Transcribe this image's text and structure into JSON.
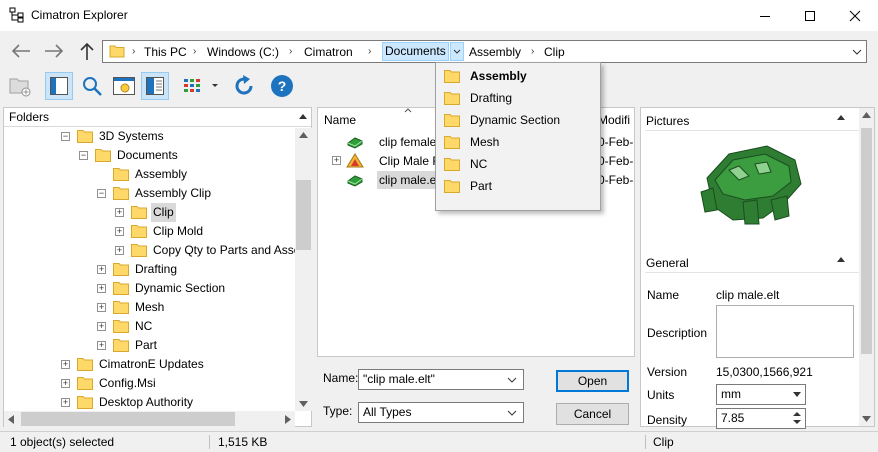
{
  "window": {
    "title": "Cimatron Explorer",
    "minimize_icon": "minimize-icon",
    "maximize_icon": "maximize-icon",
    "close_icon": "close-icon"
  },
  "address": {
    "breadcrumbs": [
      "This PC",
      "Windows (C:)",
      "Cimatron",
      "Documents",
      "Assembly",
      "Clip"
    ],
    "active_crumb": "Documents",
    "separator": "›"
  },
  "dropdown_menu": {
    "items": [
      "Assembly",
      "Drafting",
      "Dynamic Section",
      "Mesh",
      "NC",
      "Part"
    ],
    "bold_item": "Assembly"
  },
  "folders_panel": {
    "header": "Folders",
    "tree": [
      {
        "label": "3D Systems",
        "expander": "−"
      },
      {
        "label": "Documents",
        "expander": "−"
      },
      {
        "label": "Assembly",
        "expander": ""
      },
      {
        "label": "Assembly Clip",
        "expander": "−"
      },
      {
        "label": "Clip",
        "expander": "+"
      },
      {
        "label": "Clip Mold",
        "expander": "+"
      },
      {
        "label": "Copy Qty to Parts and Asse",
        "expander": "+"
      },
      {
        "label": "Drafting",
        "expander": "+"
      },
      {
        "label": "Dynamic Section",
        "expander": "+"
      },
      {
        "label": "Mesh",
        "expander": "+"
      },
      {
        "label": "NC",
        "expander": "+"
      },
      {
        "label": "Part",
        "expander": "+"
      },
      {
        "label": "CimatronE Updates",
        "expander": "+"
      },
      {
        "label": "Config.Msi",
        "expander": "+"
      },
      {
        "label": "Desktop Authority",
        "expander": "+"
      }
    ]
  },
  "files_panel": {
    "column_name": "Name",
    "column_modified": "Modifi",
    "files": [
      {
        "name": "clip female",
        "modified": "0-Feb-",
        "expander": ""
      },
      {
        "name": "Clip Male F",
        "modified": "0-Feb-",
        "expander": "+"
      },
      {
        "name": "clip male.elt",
        "modified": "0-Feb-",
        "expander": ""
      }
    ]
  },
  "file_dialog": {
    "name_label": "Name:",
    "name_value": "\"clip male.elt\"",
    "type_label": "Type:",
    "type_value": "All Types",
    "open_button": "Open",
    "cancel_button": "Cancel"
  },
  "properties_panel": {
    "pictures_title": "Pictures",
    "general_title": "General",
    "name_label": "Name",
    "name_value": "clip male.elt",
    "description_label": "Description",
    "version_label": "Version",
    "version_value": "15,0300,1566,921",
    "units_label": "Units",
    "units_value": "mm",
    "density_label": "Density",
    "density_value": "7.85",
    "part_color": "#2e7d32"
  },
  "statusbar": {
    "selection": "1 object(s) selected",
    "size": "1,515 KB",
    "current_folder": "Clip"
  },
  "colors": {
    "accent": "#0078d7",
    "folder_yellow": "#ffd86a",
    "help_blue": "#1e73be"
  }
}
